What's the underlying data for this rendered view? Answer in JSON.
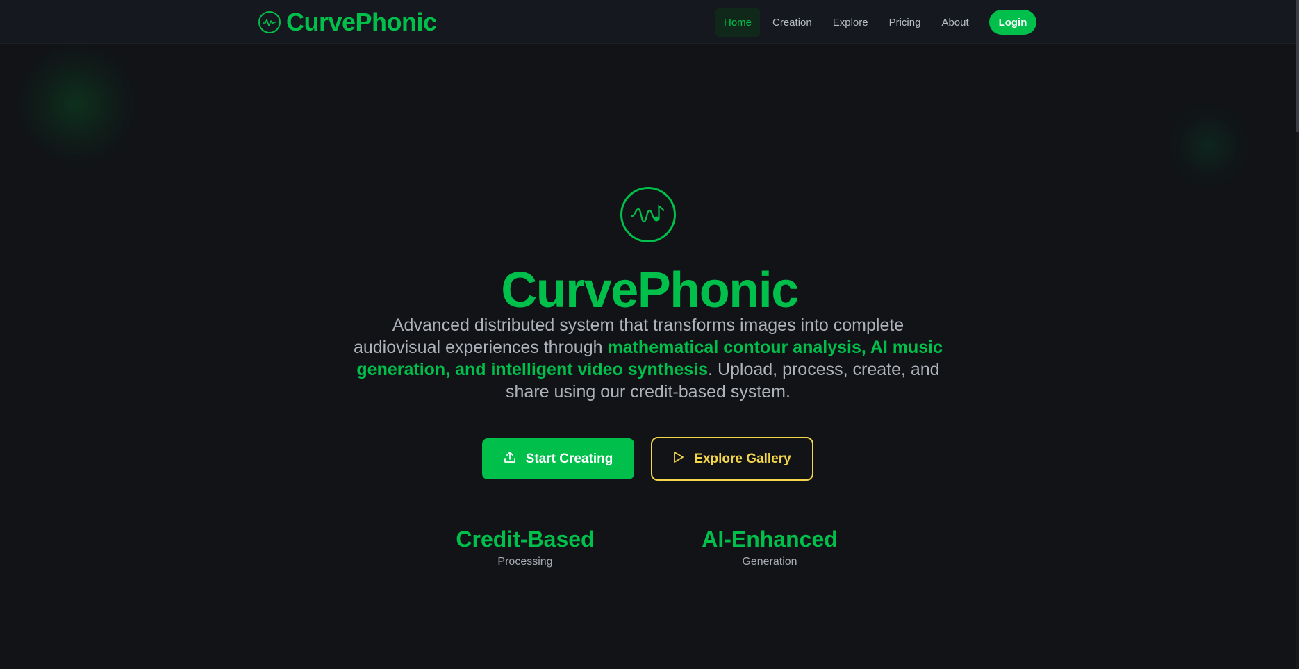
{
  "brand": {
    "name": "CurvePhonic",
    "icon": "waveform-icon"
  },
  "nav": {
    "items": [
      {
        "label": "Home",
        "active": true
      },
      {
        "label": "Creation",
        "active": false
      },
      {
        "label": "Explore",
        "active": false
      },
      {
        "label": "Pricing",
        "active": false
      },
      {
        "label": "About",
        "active": false
      }
    ],
    "login_label": "Login"
  },
  "hero": {
    "icon": "waveform-music-note-icon",
    "title": "CurvePhonic",
    "desc_pre": "Advanced distributed system that transforms images into complete audiovisual experiences through ",
    "desc_highlight": "mathematical contour analysis, AI music generation, and intelligent video synthesis",
    "desc_post": ". Upload, process, create, and share using our credit-based system.",
    "primary_cta": "Start Creating",
    "primary_icon": "upload-icon",
    "secondary_cta": "Explore Gallery",
    "secondary_icon": "play-icon"
  },
  "stats": [
    {
      "title": "Credit-Based",
      "subtitle": "Processing"
    },
    {
      "title": "AI-Enhanced",
      "subtitle": "Generation"
    }
  ],
  "colors": {
    "background": "#111317",
    "accent": "#00c04b",
    "secondary_accent": "#f2d54a",
    "text_muted": "#aeb3ba"
  }
}
